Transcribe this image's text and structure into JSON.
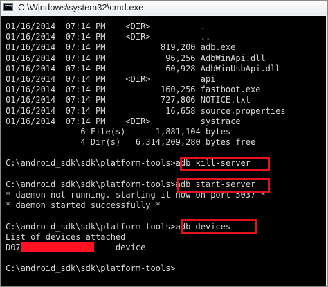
{
  "window": {
    "title": "C:\\Windows\\system32\\cmd.exe",
    "icon_text": "C:\\"
  },
  "console": {
    "lines": [
      "01/16/2014  07:14 PM    <DIR>          .",
      "01/16/2014  07:14 PM    <DIR>          ..",
      "01/16/2014  07:14 PM           819,200 adb.exe",
      "01/16/2014  07:14 PM            96,256 AdbWinApi.dll",
      "01/16/2014  07:14 PM            60,928 AdbWinUsbApi.dll",
      "01/16/2014  07:14 PM    <DIR>          api",
      "01/16/2014  07:14 PM           160,256 fastboot.exe",
      "01/16/2014  07:14 PM           727,806 NOTICE.txt",
      "01/16/2014  07:14 PM            16,658 source.properties",
      "01/16/2014  07:14 PM    <DIR>          systrace",
      "               6 File(s)      1,881,104 bytes",
      "               4 Dir(s)   6,314,209,280 bytes free",
      "",
      "C:\\android_sdk\\sdk\\platform-tools>adb kill-server",
      "",
      "C:\\android_sdk\\sdk\\platform-tools>adb start-server",
      "* daemon not running. starting it now on port 5037 *",
      "* daemon started successfully *",
      "",
      "C:\\android_sdk\\sdk\\platform-tools>adb devices",
      "List of devices attached",
      "D07                   device",
      "",
      "C:\\android_sdk\\sdk\\platform-tools>"
    ]
  },
  "annotations": {
    "highlight_color": "#e5121d",
    "redaction_color": "#ff1122"
  }
}
